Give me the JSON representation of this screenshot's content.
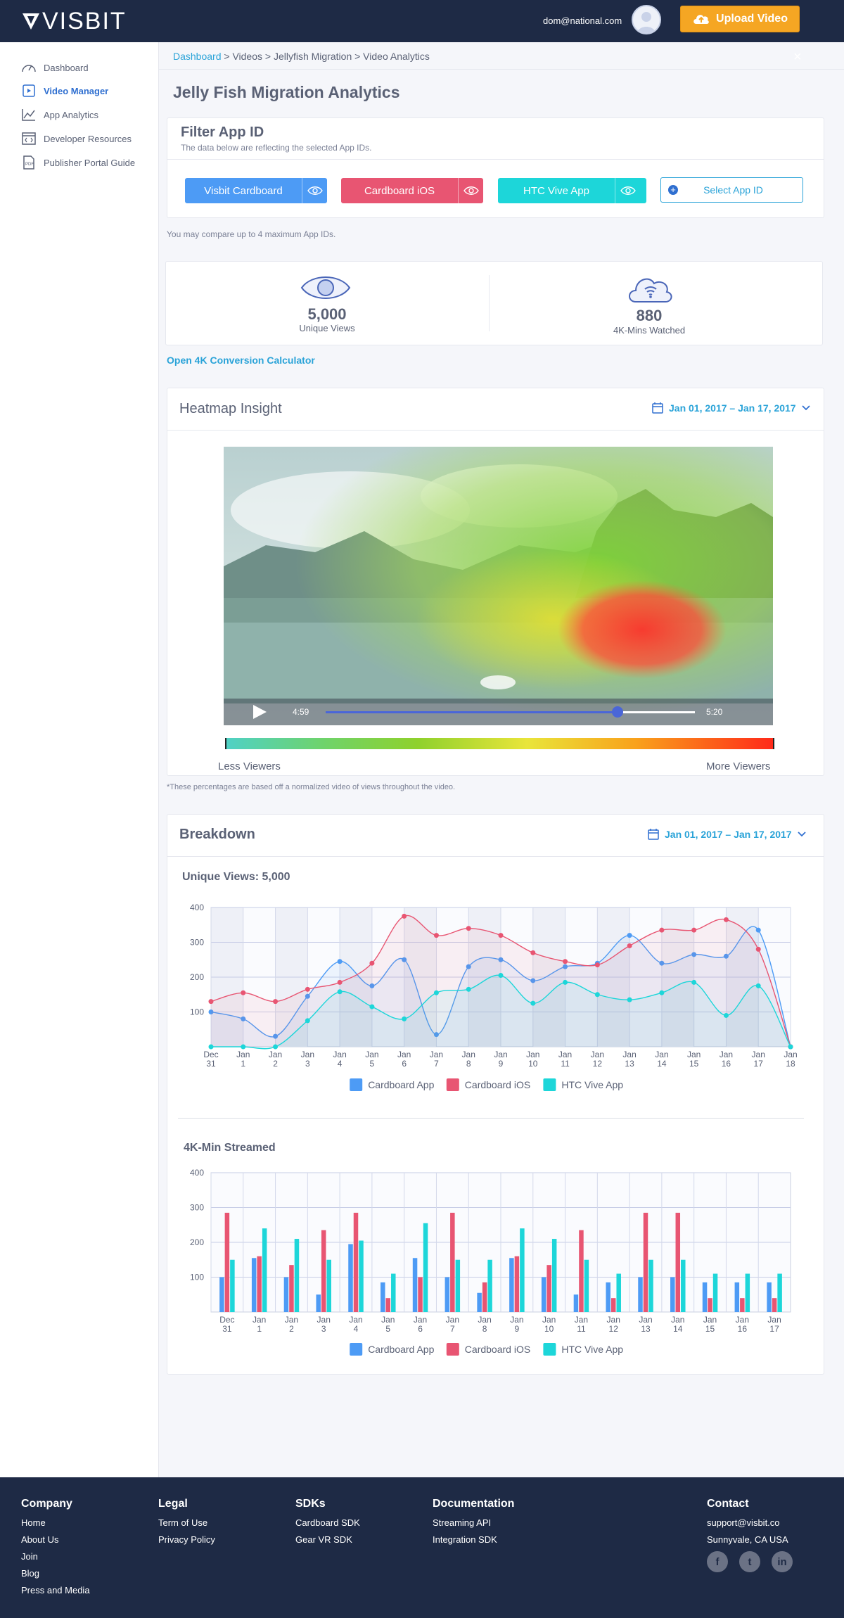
{
  "header": {
    "brand": "VISBIT",
    "user_email": "dom@national.com",
    "upload_label": "Upload Video"
  },
  "sidebar": {
    "items": [
      {
        "label": "Dashboard",
        "icon": "speedometer-icon"
      },
      {
        "label": "Video Manager",
        "icon": "video-icon"
      },
      {
        "label": "App Analytics",
        "icon": "line-chart-icon"
      },
      {
        "label": "Developer Resources",
        "icon": "code-window-icon"
      },
      {
        "label": "Publisher Portal Guide",
        "icon": "pdf-icon"
      }
    ],
    "active": "Video Manager"
  },
  "breadcrumb": {
    "home": "Dashboard",
    "rest": " > Videos > Jellyfish Migration > Video Analytics"
  },
  "page_title": "Jelly Fish Migration Analytics",
  "filter": {
    "title": "Filter App ID",
    "subtitle": "The data below are reflecting the selected App IDs.",
    "apps": [
      {
        "label": "Visbit Cardboard",
        "color": "#4d9bf5"
      },
      {
        "label": "Cardboard iOS",
        "color": "#e85572"
      },
      {
        "label": "HTC Vive App",
        "color": "#1dd6d9"
      }
    ],
    "select_label": "Select App ID",
    "note": "You may compare up to 4 maximum App IDs."
  },
  "stats": {
    "unique_views": "5,000",
    "unique_views_label": "Unique Views",
    "mins_watched": "880",
    "mins_watched_label": "4K-Mins Watched"
  },
  "calculator_link": "Open 4K Conversion Calculator",
  "heatmap": {
    "title": "Heatmap Insight",
    "date_range": "Jan 01, 2017 – Jan 17, 2017",
    "time_current": "4:59",
    "time_total": "5:20",
    "progress": 0.79,
    "less_label": "Less Viewers",
    "more_label": "More Viewers",
    "footnote": "*These percentages are based off a normalized video of views throughout the video."
  },
  "breakdown": {
    "title": "Breakdown",
    "date_range": "Jan 01, 2017 – Jan 17, 2017"
  },
  "chart_data": [
    {
      "type": "line",
      "title": "Unique Views: 5,000",
      "categories": [
        "Dec 31",
        "Jan 1",
        "Jan 2",
        "Jan 3",
        "Jan 4",
        "Jan 5",
        "Jan 6",
        "Jan 7",
        "Jan 8",
        "Jan 9",
        "Jan 10",
        "Jan 11",
        "Jan 12",
        "Jan 13",
        "Jan 14",
        "Jan 15",
        "Jan 16",
        "Jan 17",
        "Jan 18"
      ],
      "ylim": [
        0,
        400
      ],
      "yticks": [
        100,
        200,
        300,
        400
      ],
      "series": [
        {
          "name": "Cardboard App",
          "color": "#4d9bf5",
          "values": [
            100,
            80,
            30,
            145,
            245,
            175,
            250,
            35,
            230,
            250,
            190,
            230,
            240,
            320,
            240,
            265,
            260,
            335,
            0
          ]
        },
        {
          "name": "Cardboard iOS",
          "color": "#e85572",
          "values": [
            130,
            155,
            130,
            165,
            185,
            240,
            375,
            320,
            340,
            320,
            270,
            245,
            235,
            290,
            335,
            335,
            365,
            280,
            0
          ]
        },
        {
          "name": "HTC Vive App",
          "color": "#1dd6d9",
          "values": [
            0,
            0,
            0,
            75,
            158,
            115,
            80,
            155,
            165,
            205,
            125,
            185,
            150,
            135,
            155,
            185,
            90,
            175,
            0
          ]
        }
      ],
      "legend": "bottom"
    },
    {
      "type": "bar",
      "title": "4K-Min Streamed",
      "categories": [
        "Dec 31",
        "Jan 1",
        "Jan 2",
        "Jan 3",
        "Jan 4",
        "Jan 5",
        "Jan 6",
        "Jan 7",
        "Jan 8",
        "Jan 9",
        "Jan 10",
        "Jan 11",
        "Jan 12",
        "Jan 13",
        "Jan 14",
        "Jan 15",
        "Jan 16",
        "Jan 17"
      ],
      "ylim": [
        0,
        400
      ],
      "yticks": [
        100,
        200,
        300,
        400
      ],
      "series": [
        {
          "name": "Cardboard App",
          "color": "#4d9bf5",
          "values": [
            100,
            155,
            100,
            50,
            195,
            85,
            155,
            100,
            55,
            155,
            100,
            50,
            85,
            100,
            100,
            85,
            85,
            85
          ]
        },
        {
          "name": "Cardboard iOS",
          "color": "#e85572",
          "values": [
            285,
            160,
            135,
            235,
            285,
            40,
            100,
            285,
            85,
            160,
            135,
            235,
            40,
            285,
            285,
            40,
            40,
            40
          ]
        },
        {
          "name": "HTC Vive App",
          "color": "#1dd6d9",
          "values": [
            150,
            240,
            210,
            150,
            205,
            110,
            255,
            150,
            150,
            240,
            210,
            150,
            110,
            150,
            150,
            110,
            110,
            110
          ]
        }
      ],
      "legend": "bottom"
    }
  ],
  "footer": {
    "columns": [
      {
        "heading": "Company",
        "items": [
          "Home",
          "About Us",
          "Join",
          "Blog",
          "Press and Media"
        ]
      },
      {
        "heading": "Legal",
        "items": [
          "Term of Use",
          "Privacy Policy"
        ]
      },
      {
        "heading": "SDKs",
        "items": [
          "Cardboard SDK",
          "Gear VR SDK"
        ]
      },
      {
        "heading": "Documentation",
        "items": [
          "Streaming API",
          "Integration SDK"
        ]
      },
      {
        "heading": "Contact",
        "items": [
          "support@visbit.co",
          "Sunnyvale, CA USA"
        ]
      }
    ],
    "social": [
      "facebook-icon",
      "twitter-icon",
      "linkedin-icon"
    ]
  }
}
